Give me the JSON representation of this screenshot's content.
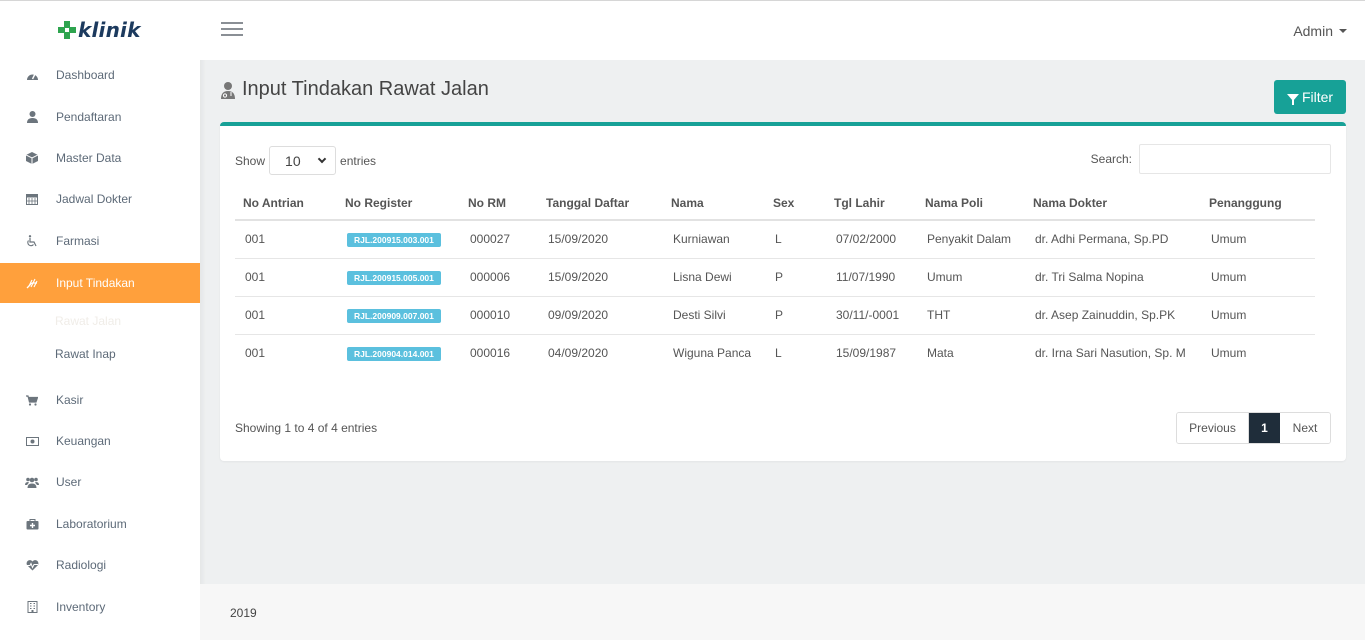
{
  "brand": {
    "name": "klinik"
  },
  "sidebar": {
    "items": [
      {
        "label": "Dashboard",
        "icon": "dashboard-icon"
      },
      {
        "label": "Pendaftaran",
        "icon": "user-icon"
      },
      {
        "label": "Master Data",
        "icon": "box-icon"
      },
      {
        "label": "Jadwal Dokter",
        "icon": "calendar-icon"
      },
      {
        "label": "Farmasi",
        "icon": "wheelchair-icon"
      },
      {
        "label": "Input Tindakan",
        "icon": "hand-medical-icon",
        "active": true
      },
      {
        "label": "Kasir",
        "icon": "cart-icon"
      },
      {
        "label": "Keuangan",
        "icon": "money-icon"
      },
      {
        "label": "User",
        "icon": "users-icon"
      },
      {
        "label": "Laboratorium",
        "icon": "medkit-icon"
      },
      {
        "label": "Radiologi",
        "icon": "heartbeat-icon"
      },
      {
        "label": "Inventory",
        "icon": "building-icon"
      }
    ],
    "subitems": [
      {
        "label": "Rawat Jalan"
      },
      {
        "label": "Rawat Inap"
      }
    ]
  },
  "topbar": {
    "user": "Admin"
  },
  "page": {
    "title": "Input Tindakan Rawat Jalan",
    "filter_label": "Filter"
  },
  "table_controls": {
    "show_label": "Show",
    "entries_value": "10",
    "entries_label": "entries",
    "search_label": "Search:",
    "search_value": "",
    "info": "Showing 1 to 4 of 4 entries",
    "prev_label": "Previous",
    "page": "1",
    "next_label": "Next"
  },
  "table": {
    "headers": [
      "No Antrian",
      "No Register",
      "No RM",
      "Tanggal Daftar",
      "Nama",
      "Sex",
      "Tgl Lahir",
      "Nama Poli",
      "Nama Dokter",
      "Penanggung"
    ],
    "rows": [
      [
        "001",
        "RJL.200915.003.001",
        "000027",
        "15/09/2020",
        "Kurniawan",
        "L",
        "07/02/2000",
        "Penyakit Dalam",
        "dr. Adhi Permana, Sp.PD",
        "Umum"
      ],
      [
        "001",
        "RJL.200915.005.001",
        "000006",
        "15/09/2020",
        "Lisna Dewi",
        "P",
        "11/07/1990",
        "Umum",
        "dr. Tri Salma Nopina",
        "Umum"
      ],
      [
        "001",
        "RJL.200909.007.001",
        "000010",
        "09/09/2020",
        "Desti Silvi",
        "P",
        "30/11/-0001",
        "THT",
        "dr. Asep Zainuddin, Sp.PK",
        "Umum"
      ],
      [
        "001",
        "RJL.200904.014.001",
        "000016",
        "04/09/2020",
        "Wiguna Panca",
        "L",
        "15/09/1987",
        "Mata",
        "dr. Irna Sari Nasution, Sp. M",
        "Umum"
      ]
    ]
  },
  "footer": {
    "text": "2019"
  },
  "colors": {
    "accent": "#17a197",
    "active_nav": "#ffa03c",
    "badge": "#5bc0de",
    "brand_green": "#2ea44f"
  }
}
